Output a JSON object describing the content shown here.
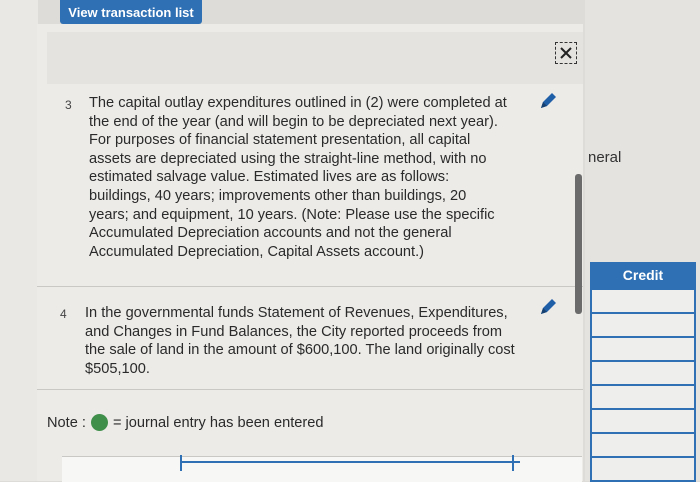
{
  "toolbar": {
    "view_transaction_list": "View transaction list"
  },
  "background": {
    "partial_label": "neral",
    "credit_header": "Credit"
  },
  "items": [
    {
      "number": "3",
      "text": "The capital outlay expenditures outlined in (2) were completed at the end of the year (and will begin to be depreciated next year). For purposes of financial statement presentation, all capital assets are depreciated using the straight-line method, with no estimated salvage value. Estimated lives are as follows: buildings, 40 years; improvements other than buildings, 20 years; and equipment, 10 years. (Note: Please use the specific Accumulated Depreciation accounts and not the general Accumulated Depreciation, Capital Assets account.)"
    },
    {
      "number": "4",
      "text": "In the governmental funds Statement of Revenues, Expenditures, and Changes in Fund Balances, the City reported proceeds from the sale of land in the amount of $600,100. The land originally cost $505,100."
    }
  ],
  "note": {
    "label": "Note :",
    "legend_text": "= journal entry has been entered"
  },
  "icons": {
    "edit": "pencil-icon",
    "close": "close-icon",
    "status": "green-dot-icon"
  },
  "colors": {
    "accent": "#2f6fb3",
    "complete": "#3f8f4a"
  }
}
